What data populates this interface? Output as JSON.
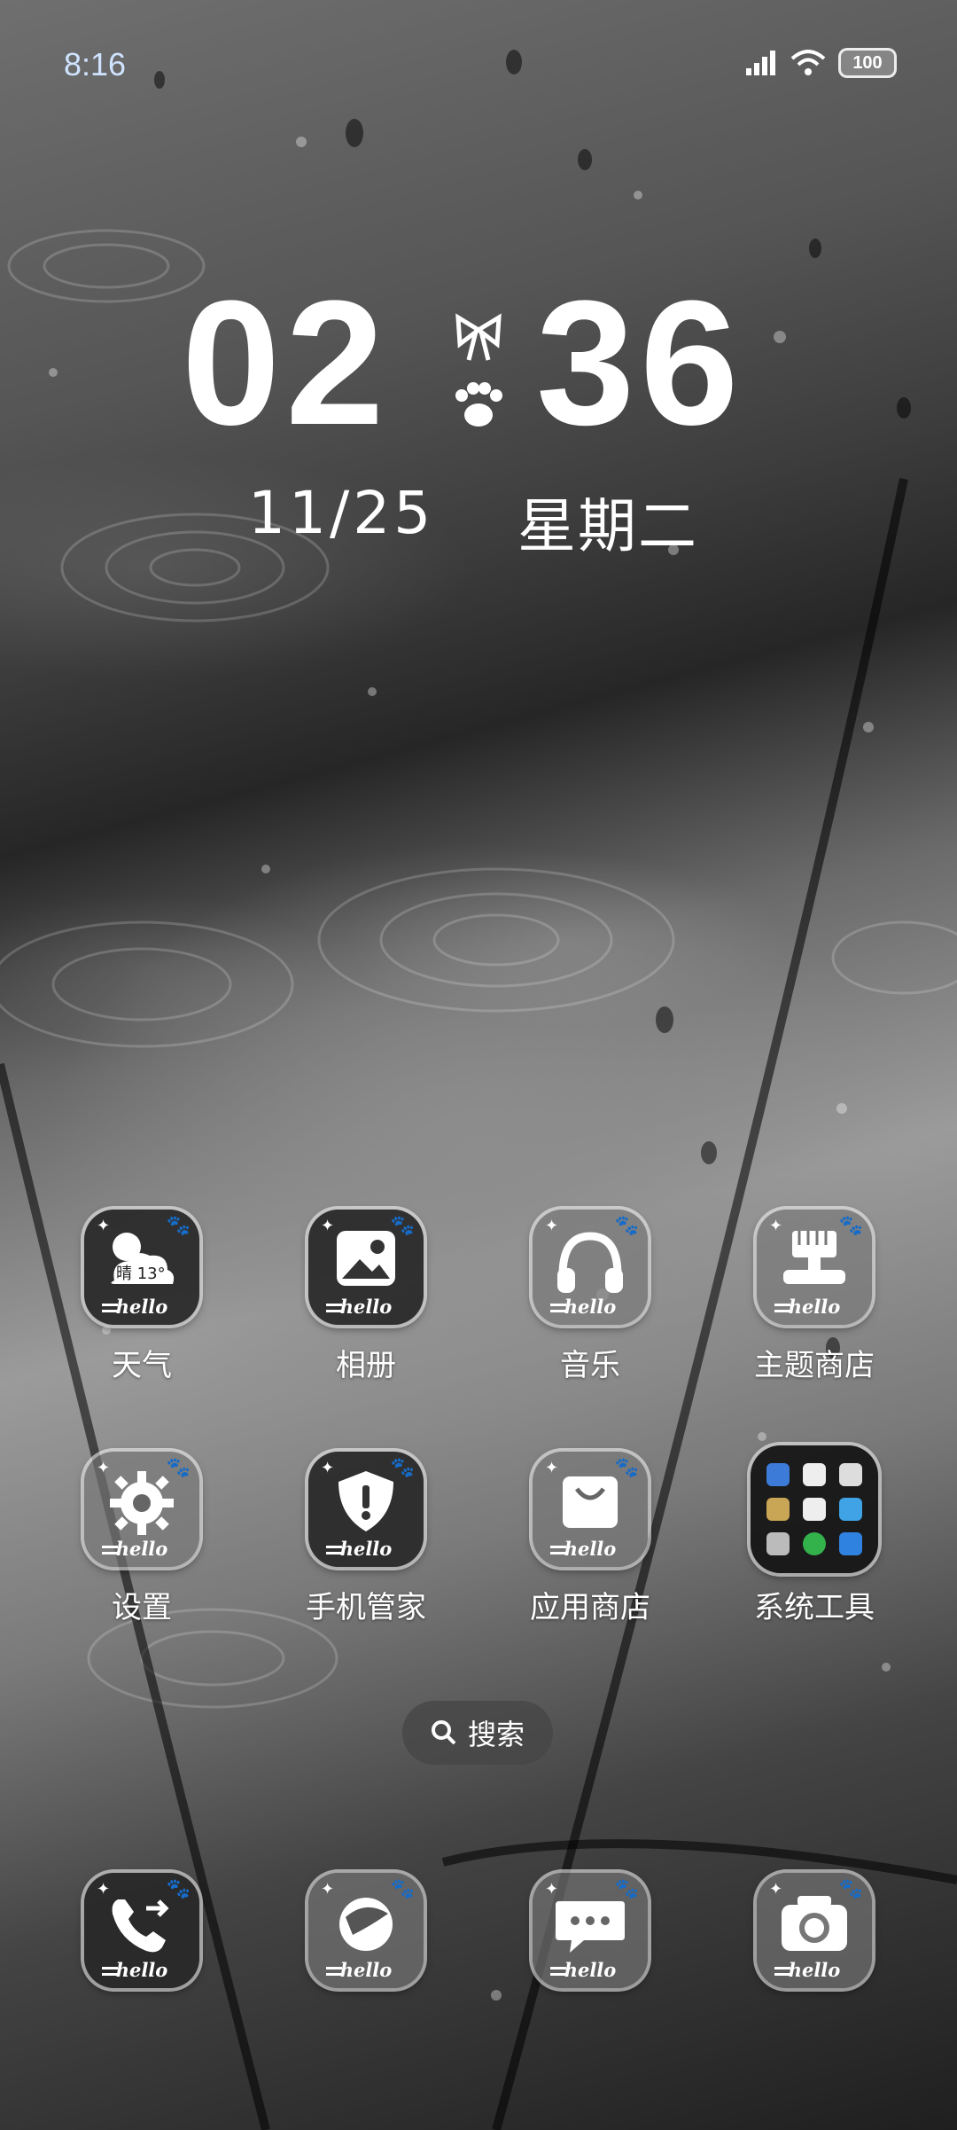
{
  "status_bar": {
    "time": "8:16",
    "battery": "100"
  },
  "lock_clock": {
    "hours": "02",
    "minutes": "36",
    "date": "11/25",
    "weekday": "星期二"
  },
  "apps": [
    {
      "label": "天气",
      "icon": "weather-icon",
      "badge_text": "晴 13°"
    },
    {
      "label": "相册",
      "icon": "gallery-icon"
    },
    {
      "label": "音乐",
      "icon": "headphones-icon"
    },
    {
      "label": "主题商店",
      "icon": "theme-store-icon"
    },
    {
      "label": "设置",
      "icon": "gear-icon"
    },
    {
      "label": "手机管家",
      "icon": "shield-icon"
    },
    {
      "label": "应用商店",
      "icon": "shopping-bag-icon"
    },
    {
      "label": "系统工具",
      "icon": "folder-icon"
    }
  ],
  "icon_caption": "hello",
  "search": {
    "label": "搜索"
  },
  "dock": [
    {
      "icon": "phone-icon"
    },
    {
      "icon": "browser-icon"
    },
    {
      "icon": "message-icon"
    },
    {
      "icon": "camera-icon"
    }
  ]
}
